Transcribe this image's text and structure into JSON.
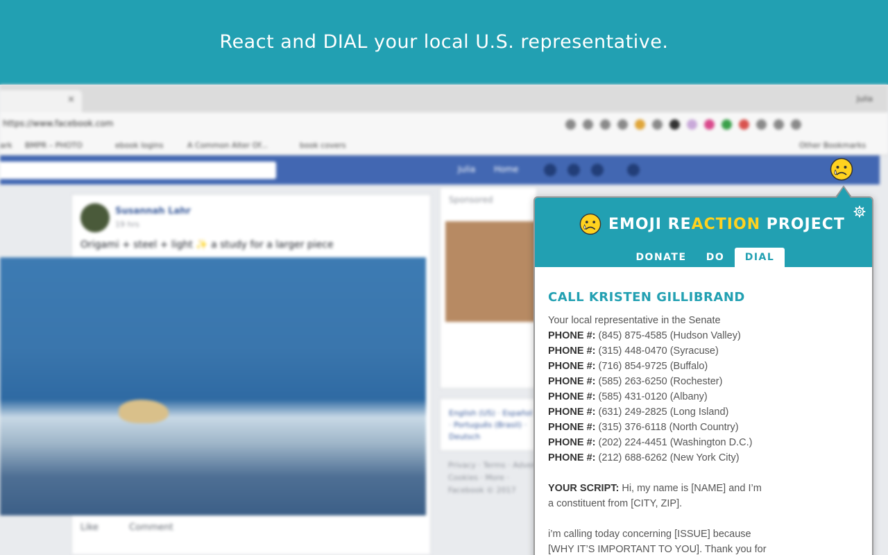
{
  "banner": {
    "text": "React and DIAL your local U.S. representative."
  },
  "browser": {
    "tab_close": "×",
    "user": "Julia",
    "url": "https://www.facebook.com",
    "bookmarks": [
      "ark",
      "BMPR – PHOTO",
      "ebook logins",
      "A Common Alter Of...",
      "book covers",
      "Other Bookmarks"
    ],
    "facebook": {
      "user_name": "Julia",
      "home_label": "Home",
      "post": {
        "author": "Susannah Lahr",
        "time": "19 hrs",
        "text": "Origami + steel + light ✨ a study for a larger piece",
        "actions": [
          "Like",
          "Comment"
        ]
      },
      "sponsored_label": "Sponsored",
      "languages": "English (US) · Español · Português (Brasil) · Deutsch",
      "footer": [
        "Privacy · Terms · Advertising ·",
        "Cookies · More ·",
        "Facebook © 2017"
      ]
    }
  },
  "popup": {
    "logo": {
      "part1": "EMOJI RE",
      "accent": "ACTION",
      "part2": " PROJECT"
    },
    "tabs": [
      {
        "label": "DONATE",
        "active": false
      },
      {
        "label": "DO",
        "active": false
      },
      {
        "label": "DIAL",
        "active": true
      }
    ],
    "title": "CALL KRISTEN GILLIBRAND",
    "subtitle": "Your local representative in the Senate",
    "phone_label": "PHONE #:",
    "phones": [
      "(845) 875-4585 (Hudson Valley)",
      "(315) 448-0470 (Syracuse)",
      "(716) 854-9725 (Buffalo)",
      "(585) 263-6250 (Rochester)",
      "(585) 431-0120 (Albany)",
      "(631) 249-2825 (Long Island)",
      "(315) 376-6118 (North Country)",
      "(202) 224-4451 (Washington D.C.)",
      "(212) 688-6262 (New York City)"
    ],
    "script_label": "YOUR SCRIPT:",
    "script_line1": " Hi, my name is [NAME] and I’m",
    "script_line2": "a constituent from [CITY, ZIP].",
    "script_line3": "i’m calling today concerning [ISSUE] because",
    "script_line4": "[WHY IT’S IMPORTANT TO YOU]. Thank you for"
  },
  "colors": {
    "teal": "#22a0b2",
    "yellow": "#ffd21f",
    "facebook_blue": "#4267b2"
  },
  "icons": {
    "toolbar": "sad-emoji-icon",
    "settings": "gear-icon",
    "logo": "sad-emoji-icon"
  }
}
